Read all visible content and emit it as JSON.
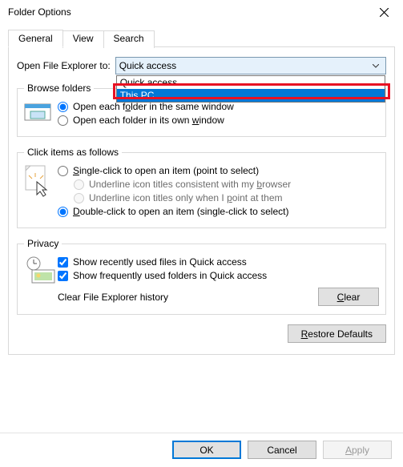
{
  "window": {
    "title": "Folder Options"
  },
  "tabs": {
    "general": "General",
    "view": "View",
    "search": "Search"
  },
  "open_to": {
    "label": "Open File Explorer to:",
    "value": "Quick access",
    "options": [
      "Quick access",
      "This PC"
    ]
  },
  "browse": {
    "legend": "Browse folders",
    "same_window": "Open each folder in the same window",
    "own_window": "Open each folder in its own window"
  },
  "click": {
    "legend": "Click items as follows",
    "single": "Single-click to open an item (point to select)",
    "underline_browser": "Underline icon titles consistent with my browser",
    "underline_point": "Underline icon titles only when I point at them",
    "double": "Double-click to open an item (single-click to select)"
  },
  "privacy": {
    "legend": "Privacy",
    "recent_files": "Show recently used files in Quick access",
    "frequent_folders": "Show frequently used folders in Quick access",
    "clear_label": "Clear File Explorer history",
    "clear_btn": "Clear"
  },
  "restore_btn": "Restore Defaults",
  "buttons": {
    "ok": "OK",
    "cancel": "Cancel",
    "apply": "Apply"
  }
}
